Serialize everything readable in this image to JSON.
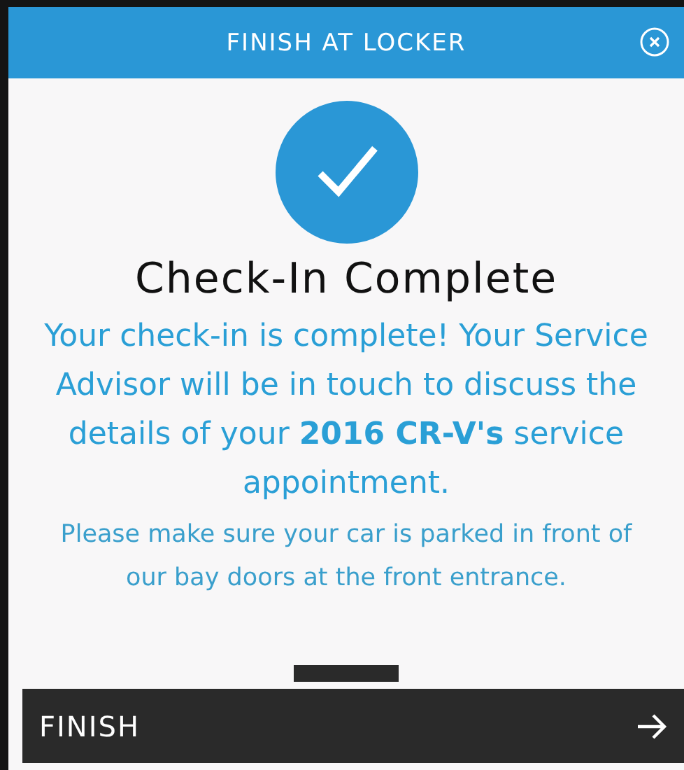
{
  "header": {
    "title": "FINISH AT LOCKER"
  },
  "status": {
    "title": "Check-In Complete",
    "message": "Your check-in is complete! Your Service Advisor will be in touch to discuss the details of your **2016 CR-V's** service appointment.",
    "note": "Please make sure your car is parked in front of our bay doors at the front entrance."
  },
  "finish_button": {
    "label": "FINISH"
  }
}
